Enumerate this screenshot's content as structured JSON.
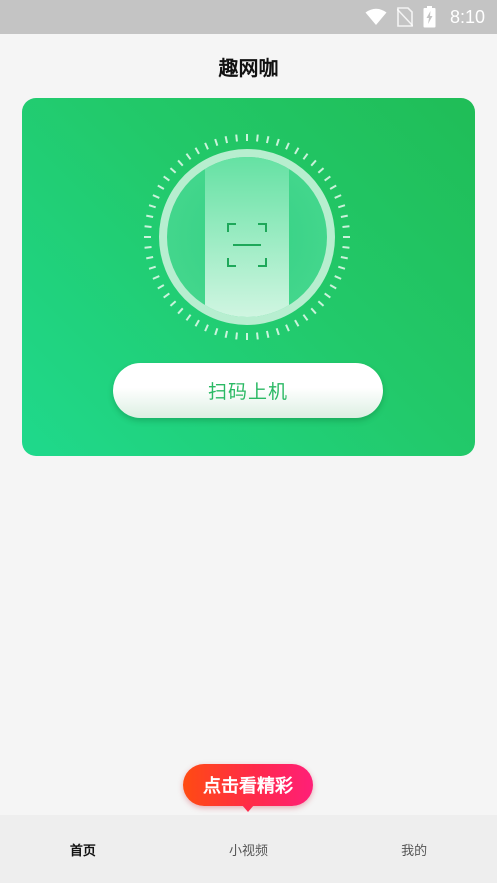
{
  "status_bar": {
    "time": "8:10",
    "icons": [
      "wifi-icon",
      "no-sim-icon",
      "battery-charging-icon"
    ]
  },
  "header": {
    "title": "趣网咖"
  },
  "scan_card": {
    "button_label": "扫码上机",
    "colors": {
      "gradient_start": "#1fd98c",
      "gradient_end": "#20bd57",
      "button_text": "#2bb964"
    },
    "icon": "phone-scan-icon"
  },
  "promo": {
    "label": "点击看精彩",
    "colors": {
      "start": "#ff4b12",
      "end": "#ff1f78"
    }
  },
  "bottom_nav": {
    "tabs": [
      {
        "label": "首页",
        "active": true
      },
      {
        "label": "小视频",
        "active": false
      },
      {
        "label": "我的",
        "active": false
      }
    ]
  }
}
